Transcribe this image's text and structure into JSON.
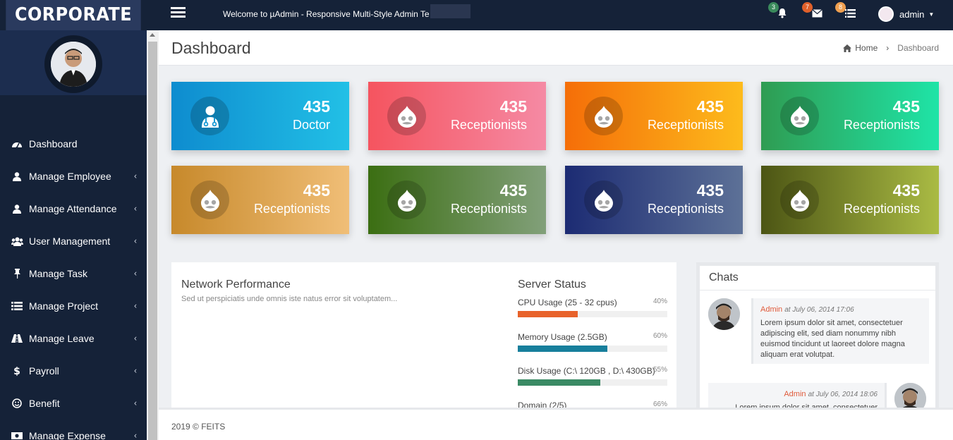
{
  "brand": "CORPORATE",
  "profile": {
    "name": "admin"
  },
  "menu": [
    {
      "label": "Dashboard",
      "icon": "dashboard-icon",
      "has_submenu": false
    },
    {
      "label": "Manage Employee",
      "icon": "user-icon",
      "has_submenu": true
    },
    {
      "label": "Manage Attendance",
      "icon": "user-icon",
      "has_submenu": true
    },
    {
      "label": "User Management",
      "icon": "users-icon",
      "has_submenu": true
    },
    {
      "label": "Manage Task",
      "icon": "pin-icon",
      "has_submenu": true
    },
    {
      "label": "Manage Project",
      "icon": "list-icon",
      "has_submenu": true
    },
    {
      "label": "Manage Leave",
      "icon": "road-icon",
      "has_submenu": true
    },
    {
      "label": "Payroll",
      "icon": "dollar-icon",
      "has_submenu": true
    },
    {
      "label": "Benefit",
      "icon": "smile-icon",
      "has_submenu": true
    },
    {
      "label": "Manage Expense",
      "icon": "money-icon",
      "has_submenu": true
    }
  ],
  "topbar": {
    "welcome": "Welcome to µAdmin - Responsive Multi-Style Admin Te",
    "notifications": {
      "count": "3",
      "color": "#3a8a5c"
    },
    "messages": {
      "count": "7",
      "color": "#e0602a"
    },
    "tasks": {
      "count": "8",
      "color": "#f0a050"
    },
    "user": "admin"
  },
  "page": {
    "title": "Dashboard",
    "breadcrumb": {
      "home": "Home",
      "current": "Dashboard"
    }
  },
  "cards": [
    {
      "value": "435",
      "label": "Doctor",
      "icon": "doctor-icon",
      "gradient": [
        "#0e8ccf",
        "#22c0e6"
      ]
    },
    {
      "value": "435",
      "label": "Receptionists",
      "icon": "drupal-icon",
      "gradient": [
        "#f5545f",
        "#f58aa4"
      ]
    },
    {
      "value": "435",
      "label": "Receptionists",
      "icon": "drupal-icon",
      "gradient": [
        "#f56e08",
        "#fdbb1c"
      ]
    },
    {
      "value": "435",
      "label": "Receptionists",
      "icon": "drupal-icon",
      "gradient": [
        "#2f9c52",
        "#1fe4a7"
      ]
    },
    {
      "value": "435",
      "label": "Receptionists",
      "icon": "drupal-icon",
      "gradient": [
        "#c7892b",
        "#f0be77"
      ]
    },
    {
      "value": "435",
      "label": "Receptionists",
      "icon": "drupal-icon",
      "gradient": [
        "#3b6e12",
        "#82a07a"
      ]
    },
    {
      "value": "435",
      "label": "Receptionists",
      "icon": "drupal-icon",
      "gradient": [
        "#1c2b73",
        "#5d7197"
      ]
    },
    {
      "value": "435",
      "label": "Receptionists",
      "icon": "drupal-icon",
      "gradient": [
        "#4c5514",
        "#aabb44"
      ]
    }
  ],
  "network": {
    "title": "Network Performance",
    "description": "Sed ut perspiciatis unde omnis iste natus error sit voluptatem..."
  },
  "server": {
    "title": "Server Status",
    "rows": [
      {
        "label": "CPU Usage (25 - 32 cpus)",
        "percent": "40%",
        "value": 40,
        "color": "#e8622a"
      },
      {
        "label": "Memory Usage (2.5GB)",
        "percent": "60%",
        "value": 60,
        "color": "#177f9c"
      },
      {
        "label": "Disk Usage (C:\\ 120GB , D:\\ 430GB)",
        "percent": "55%",
        "value": 55,
        "color": "#3a8a64"
      },
      {
        "label": "Domain (2/5)",
        "percent": "66%",
        "value": 66,
        "color": "#6a6adc"
      }
    ]
  },
  "chats": {
    "title": "Chats",
    "messages": [
      {
        "author": "Admin",
        "time": "at July 06, 2014 17:06",
        "text": "Lorem ipsum dolor sit amet, consectetuer adipiscing elit, sed diam nonummy nibh euismod tincidunt ut laoreet dolore magna aliquam erat volutpat."
      },
      {
        "author": "Admin",
        "time": "at July 06, 2014 18:06",
        "text": "Lorem ipsum dolor sit amet, consectetuer"
      }
    ]
  },
  "footer": "2019 © FEITS"
}
